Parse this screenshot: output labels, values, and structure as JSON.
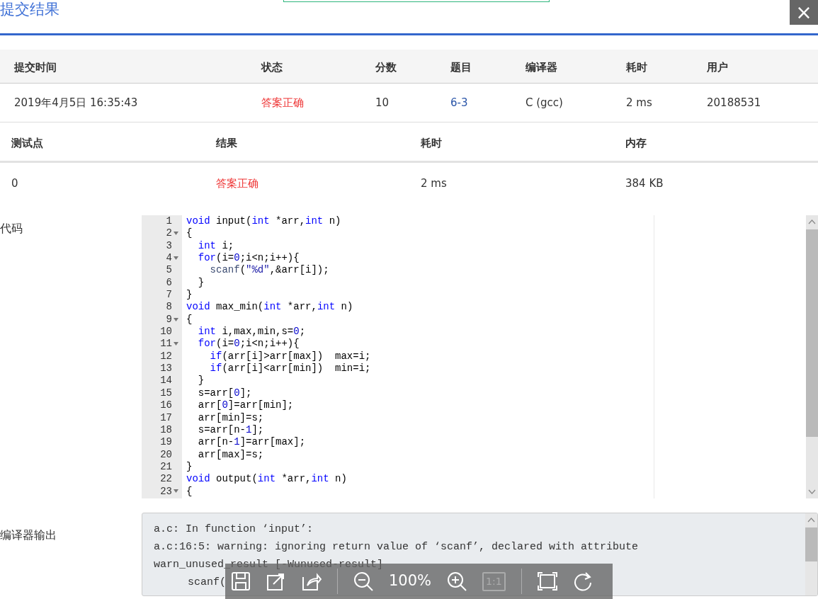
{
  "dialog": {
    "title": "提交结果",
    "close": "×"
  },
  "submission": {
    "columns": [
      "提交时间",
      "状态",
      "分数",
      "题目",
      "编译器",
      "耗时",
      "用户"
    ],
    "row": {
      "time": "2019年4月5日 16:35:43",
      "status": "答案正确",
      "score": "10",
      "problem": "6-3",
      "compiler": "C (gcc)",
      "elapsed": "2 ms",
      "user": "20188531"
    }
  },
  "testcases": {
    "columns": [
      "测试点",
      "结果",
      "耗时",
      "内存"
    ],
    "rows": [
      {
        "cells": [
          "0",
          "答案正确",
          "2 ms",
          "384 KB"
        ]
      }
    ]
  },
  "code": {
    "label": "代码",
    "lines": [
      {
        "number": "1",
        "foldable": false,
        "tokens": [
          {
            "text": "void",
            "kind": "kw"
          },
          {
            "text": " input(",
            "kind": "p"
          },
          {
            "text": "int",
            "kind": "kw"
          },
          {
            "text": " *arr,",
            "kind": "p"
          },
          {
            "text": "int",
            "kind": "kw"
          },
          {
            "text": " n)",
            "kind": "p"
          }
        ]
      },
      {
        "number": "2",
        "foldable": true,
        "tokens": [
          {
            "text": "{",
            "kind": "p"
          }
        ]
      },
      {
        "number": "3",
        "foldable": false,
        "tokens": [
          {
            "text": "  int",
            "kind": "kw"
          },
          {
            "text": " i;",
            "kind": "p"
          }
        ]
      },
      {
        "number": "4",
        "foldable": true,
        "tokens": [
          {
            "text": "  for",
            "kind": "kw"
          },
          {
            "text": "(i=",
            "kind": "p"
          },
          {
            "text": "0",
            "kind": "num"
          },
          {
            "text": ";i<n;i++){",
            "kind": "p"
          }
        ]
      },
      {
        "number": "5",
        "foldable": false,
        "tokens": [
          {
            "text": "    scanf",
            "kind": "fn"
          },
          {
            "text": "(",
            "kind": "p"
          },
          {
            "text": "\"%d\"",
            "kind": "str"
          },
          {
            "text": ",&arr[i]);",
            "kind": "p"
          }
        ]
      },
      {
        "number": "6",
        "foldable": false,
        "tokens": [
          {
            "text": "  }",
            "kind": "p"
          }
        ]
      },
      {
        "number": "7",
        "foldable": false,
        "tokens": [
          {
            "text": "}",
            "kind": "p"
          }
        ]
      },
      {
        "number": "8",
        "foldable": false,
        "tokens": [
          {
            "text": "void",
            "kind": "kw"
          },
          {
            "text": " max_min(",
            "kind": "p"
          },
          {
            "text": "int",
            "kind": "kw"
          },
          {
            "text": " *arr,",
            "kind": "p"
          },
          {
            "text": "int",
            "kind": "kw"
          },
          {
            "text": " n)",
            "kind": "p"
          }
        ]
      },
      {
        "number": "9",
        "foldable": true,
        "tokens": [
          {
            "text": "{",
            "kind": "p"
          }
        ]
      },
      {
        "number": "10",
        "foldable": false,
        "tokens": [
          {
            "text": "  int",
            "kind": "kw"
          },
          {
            "text": " i,max,min,s=",
            "kind": "p"
          },
          {
            "text": "0",
            "kind": "num"
          },
          {
            "text": ";",
            "kind": "p"
          }
        ]
      },
      {
        "number": "11",
        "foldable": true,
        "tokens": [
          {
            "text": "  for",
            "kind": "kw"
          },
          {
            "text": "(i=",
            "kind": "p"
          },
          {
            "text": "0",
            "kind": "num"
          },
          {
            "text": ";i<n;i++){",
            "kind": "p"
          }
        ]
      },
      {
        "number": "12",
        "foldable": false,
        "tokens": [
          {
            "text": "    if",
            "kind": "kw"
          },
          {
            "text": "(arr[i]>arr[max])  max=i;",
            "kind": "p"
          }
        ]
      },
      {
        "number": "13",
        "foldable": false,
        "tokens": [
          {
            "text": "    if",
            "kind": "kw"
          },
          {
            "text": "(arr[i]<arr[min])  min=i;",
            "kind": "p"
          }
        ]
      },
      {
        "number": "14",
        "foldable": false,
        "tokens": [
          {
            "text": "  }",
            "kind": "p"
          }
        ]
      },
      {
        "number": "15",
        "foldable": false,
        "tokens": [
          {
            "text": "  s=arr[",
            "kind": "p"
          },
          {
            "text": "0",
            "kind": "num"
          },
          {
            "text": "];",
            "kind": "p"
          }
        ]
      },
      {
        "number": "16",
        "foldable": false,
        "tokens": [
          {
            "text": "  arr[",
            "kind": "p"
          },
          {
            "text": "0",
            "kind": "num"
          },
          {
            "text": "]=arr[min];",
            "kind": "p"
          }
        ]
      },
      {
        "number": "17",
        "foldable": false,
        "tokens": [
          {
            "text": "  arr[min]=s;",
            "kind": "p"
          }
        ]
      },
      {
        "number": "18",
        "foldable": false,
        "tokens": [
          {
            "text": "  s=arr[n-",
            "kind": "p"
          },
          {
            "text": "1",
            "kind": "num"
          },
          {
            "text": "];",
            "kind": "p"
          }
        ]
      },
      {
        "number": "19",
        "foldable": false,
        "tokens": [
          {
            "text": "  arr[n-",
            "kind": "p"
          },
          {
            "text": "1",
            "kind": "num"
          },
          {
            "text": "]=arr[max];",
            "kind": "p"
          }
        ]
      },
      {
        "number": "20",
        "foldable": false,
        "tokens": [
          {
            "text": "  arr[max]=s;",
            "kind": "p"
          }
        ]
      },
      {
        "number": "21",
        "foldable": false,
        "tokens": [
          {
            "text": "}",
            "kind": "p"
          }
        ]
      },
      {
        "number": "22",
        "foldable": false,
        "tokens": [
          {
            "text": "void",
            "kind": "kw"
          },
          {
            "text": " output(",
            "kind": "p"
          },
          {
            "text": "int",
            "kind": "kw"
          },
          {
            "text": " *arr,",
            "kind": "p"
          },
          {
            "text": "int",
            "kind": "kw"
          },
          {
            "text": " n)",
            "kind": "p"
          }
        ]
      },
      {
        "number": "23",
        "foldable": true,
        "tokens": [
          {
            "text": "{",
            "kind": "p"
          }
        ]
      }
    ]
  },
  "compiler_output": {
    "label": "编译器输出",
    "lines": [
      "a.c: In function ‘input’:",
      "a.c:16:5: warning: ignoring return value of ‘scanf’, declared with attribute",
      "warn_unused_result [-Wunused-result]",
      "scanf("
    ]
  },
  "viewer_toolbar": [
    {
      "kind": "save",
      "disabled": false
    },
    {
      "kind": "export",
      "disabled": false
    },
    {
      "kind": "share",
      "disabled": false
    },
    {
      "kind": "separator"
    },
    {
      "kind": "zoom_out",
      "disabled": false
    },
    {
      "kind": "text",
      "text": "100%"
    },
    {
      "kind": "zoom_in",
      "disabled": false
    },
    {
      "kind": "actual_size",
      "text": "1:1",
      "disabled": true
    },
    {
      "kind": "separator"
    },
    {
      "kind": "fullscreen",
      "disabled": false
    },
    {
      "kind": "rotate",
      "disabled": false
    }
  ]
}
